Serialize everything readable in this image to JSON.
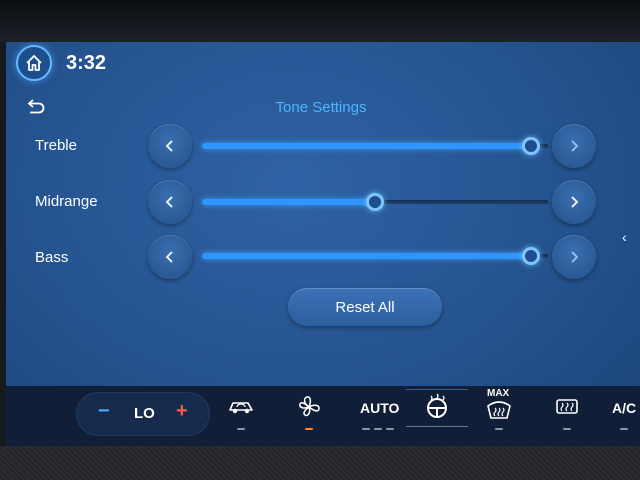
{
  "status": {
    "time": "3:32",
    "home_icon": "home-icon"
  },
  "header": {
    "title": "Tone Settings",
    "back_icon": "back-arrow-icon"
  },
  "tone": {
    "rows": [
      {
        "label": "Treble",
        "level": 0.95
      },
      {
        "label": "Midrange",
        "level": 0.5
      },
      {
        "label": "Bass",
        "level": 0.95
      }
    ],
    "reset_label": "Reset All"
  },
  "climate": {
    "temp_value": "LO",
    "auto_label": "AUTO",
    "max_label": "MAX",
    "ac_label": "A/C",
    "icons": [
      "recirculation-icon",
      "fan-icon",
      "heated-steering-icon",
      "max-defrost-icon",
      "rear-defrost-icon"
    ]
  },
  "colors": {
    "accent": "#4db4ff",
    "screen": "#2a5a96",
    "active_indicator": "#ff8a1a"
  }
}
